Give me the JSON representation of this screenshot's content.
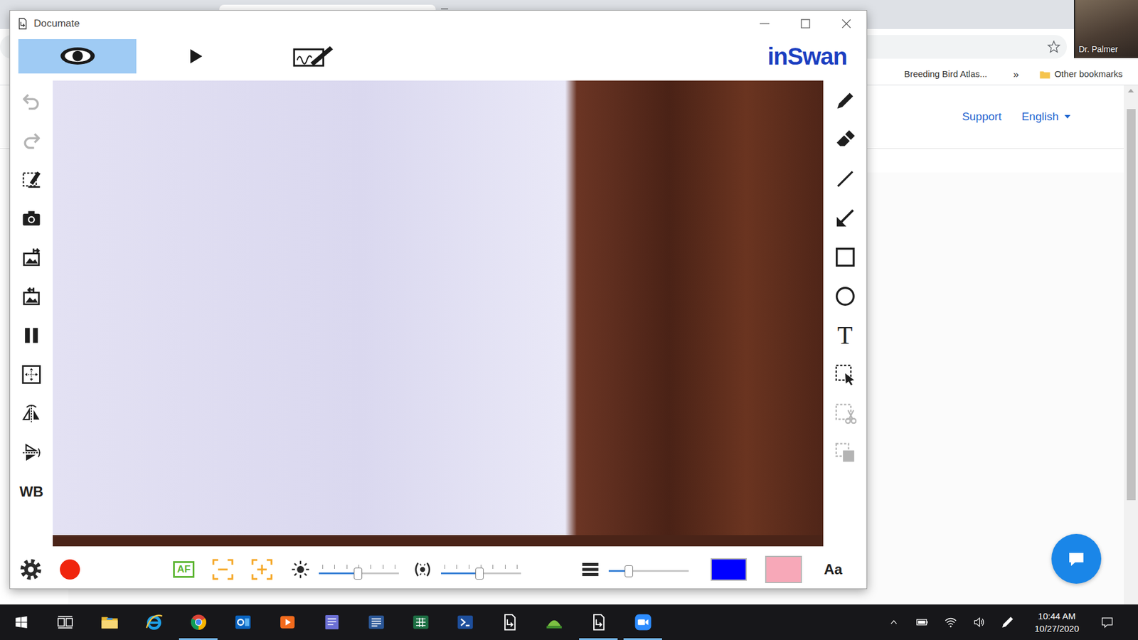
{
  "browser": {
    "bookmarks": [
      {
        "label": "Breeding Bird Atlas...",
        "kind": "page"
      },
      {
        "label": "»",
        "kind": "overflow"
      },
      {
        "label": "Other bookmarks",
        "kind": "folder"
      }
    ],
    "links": [
      {
        "label": "Support",
        "dropdown": false
      },
      {
        "label": "English",
        "dropdown": true
      }
    ]
  },
  "zoom": {
    "participant": "Dr. Palmer"
  },
  "documate": {
    "title": "Documate",
    "logo": "inSwan",
    "modes": [
      {
        "kind": "view",
        "selected": true
      },
      {
        "kind": "play",
        "selected": false
      },
      {
        "kind": "annotate",
        "selected": false
      }
    ],
    "left_tools": [
      {
        "kind": "undo",
        "disabled": true
      },
      {
        "kind": "redo",
        "disabled": true
      },
      {
        "kind": "clear",
        "disabled": false
      },
      {
        "kind": "capture",
        "disabled": false
      },
      {
        "kind": "import",
        "disabled": false
      },
      {
        "kind": "export",
        "disabled": false
      },
      {
        "kind": "freeze",
        "disabled": false
      },
      {
        "kind": "fit",
        "disabled": false
      },
      {
        "kind": "mirror",
        "disabled": false
      },
      {
        "kind": "flip",
        "disabled": false
      },
      {
        "kind": "whiteboard",
        "disabled": false,
        "label": "WB"
      }
    ],
    "right_tools": [
      {
        "kind": "pen",
        "disabled": false
      },
      {
        "kind": "eraser",
        "disabled": false
      },
      {
        "kind": "line",
        "disabled": false
      },
      {
        "kind": "arrow",
        "disabled": false
      },
      {
        "kind": "rectangle",
        "disabled": false
      },
      {
        "kind": "ellipse",
        "disabled": false
      },
      {
        "kind": "text",
        "disabled": false,
        "label": "T"
      },
      {
        "kind": "select",
        "disabled": false
      },
      {
        "kind": "cut",
        "disabled": true
      },
      {
        "kind": "copy",
        "disabled": true
      }
    ],
    "bottom": {
      "buttons": [
        {
          "kind": "settings"
        },
        {
          "kind": "record"
        },
        {
          "kind": "autofocus",
          "label": "AF"
        },
        {
          "kind": "zoom-out"
        },
        {
          "kind": "zoom-in"
        }
      ],
      "sliders": [
        {
          "kind": "brightness",
          "level": 0.49
        },
        {
          "kind": "focus",
          "level": 0.48
        },
        {
          "kind": "line-width",
          "level": 0.25
        }
      ],
      "swatches": [
        {
          "kind": "pen-color",
          "color": "#0000ff"
        },
        {
          "kind": "fill-color",
          "color": "#f7a8b8"
        }
      ],
      "font_label": "Aa"
    }
  },
  "taskbar": {
    "apps": [
      {
        "kind": "start",
        "active": false
      },
      {
        "kind": "task-view",
        "active": false
      },
      {
        "kind": "explorer",
        "active": false
      },
      {
        "kind": "ie",
        "active": false
      },
      {
        "kind": "chrome",
        "active": true
      },
      {
        "kind": "outlook",
        "active": false
      },
      {
        "kind": "media",
        "active": false
      },
      {
        "kind": "scanner",
        "active": false
      },
      {
        "kind": "word",
        "active": false
      },
      {
        "kind": "excel",
        "active": false
      },
      {
        "kind": "powershell",
        "active": false
      },
      {
        "kind": "documate",
        "active": false
      },
      {
        "kind": "maps",
        "active": false
      },
      {
        "kind": "documate",
        "active": true
      },
      {
        "kind": "zoom",
        "active": true
      }
    ],
    "tray": [
      {
        "kind": "overflow"
      },
      {
        "kind": "battery"
      },
      {
        "kind": "network"
      },
      {
        "kind": "volume"
      },
      {
        "kind": "pen"
      }
    ],
    "clock": {
      "time": "10:44 AM",
      "date": "10/27/2020"
    }
  }
}
